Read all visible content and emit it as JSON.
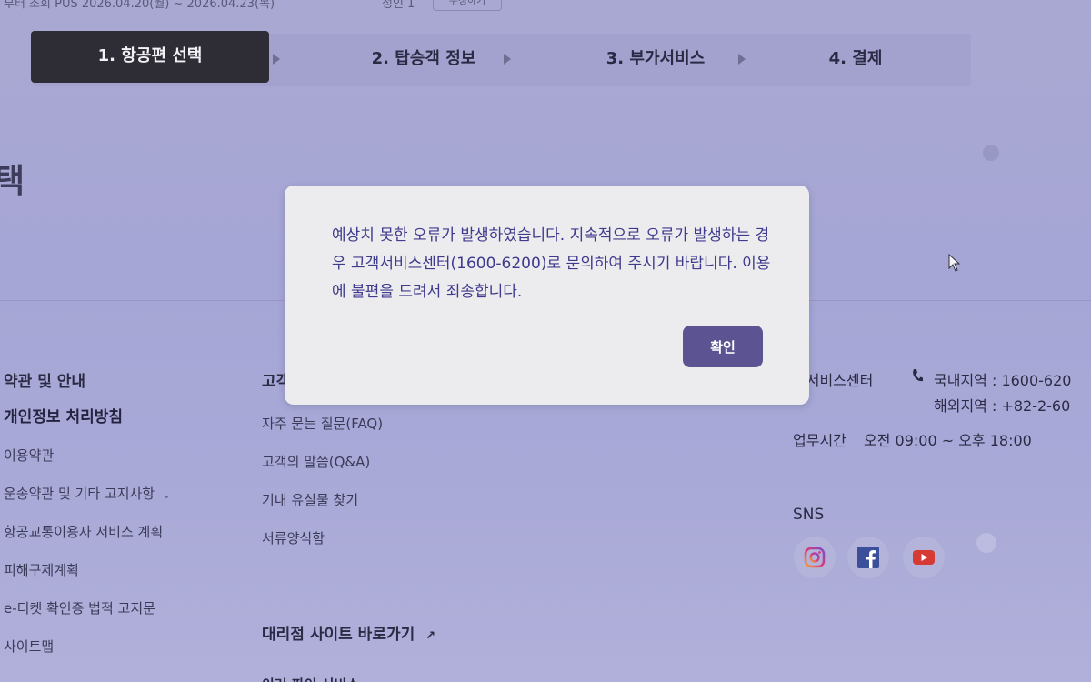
{
  "top_strip": {
    "left_text": "부터 조회 PUS  2026.04.20(월) ~ 2026.04.23(목)",
    "right_text": "성인 1",
    "button_label": "수정하기"
  },
  "stepper": {
    "steps": [
      {
        "label": "1. 항공편 선택",
        "active": true
      },
      {
        "label": "2. 탑승객 정보",
        "active": false
      },
      {
        "label": "3. 부가서비스",
        "active": false
      },
      {
        "label": "4. 결제",
        "active": false
      }
    ]
  },
  "page_heading": "택",
  "modal": {
    "message": "예상치 못한 오류가 발생하였습니다. 지속적으로 오류가 발생하는 경우 고객서비스센터(1600-6200)로 문의하여 주시기 바랍니다. 이용에 불편을 드려서 죄송합니다.",
    "confirm_label": "확인"
  },
  "footer": {
    "col1": {
      "heading": "약관 및 안내",
      "links": [
        {
          "label": "개인정보 처리방침",
          "bold": true
        },
        {
          "label": "이용약관"
        },
        {
          "label": "운송약관 및 기타 고지사항",
          "has_chevron": true
        },
        {
          "label": "항공교통이용자 서비스 계획"
        },
        {
          "label": "피해구제계획"
        },
        {
          "label": "e-티켓 확인증 법적 고지문"
        },
        {
          "label": "사이트맵"
        }
      ]
    },
    "col2": {
      "heading": "고객",
      "links": [
        {
          "label": "자주 묻는 질문(FAQ)"
        },
        {
          "label": "고객의 말씀(Q&A)"
        },
        {
          "label": "기내 유실물 찾기"
        },
        {
          "label": "서류양식함"
        }
      ],
      "agency_link": "대리점 사이트 바로가기",
      "cut_text": "이러 파이 서비스"
    },
    "contact": {
      "center_label": "객서비스센터",
      "domestic_label": "국내지역 : 1600-620",
      "overseas_label": "해외지역 : +82-2-60",
      "hours_label": "업무시간",
      "hours_value": "오전 09:00 ~ 오후 18:00"
    },
    "sns": {
      "title": "SNS",
      "icons": [
        "instagram-icon",
        "facebook-icon",
        "youtube-icon"
      ]
    }
  }
}
